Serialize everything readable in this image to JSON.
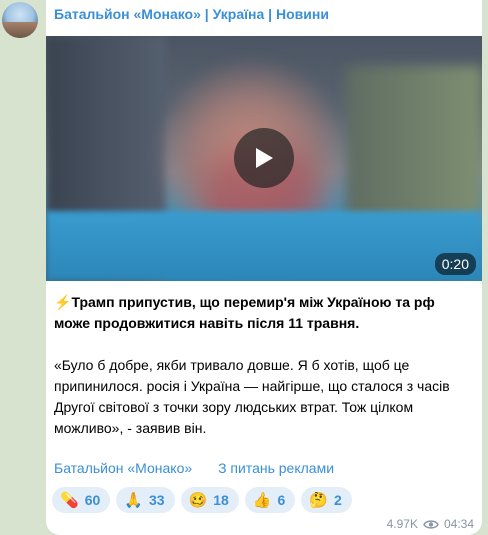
{
  "channel": {
    "title": "Батальйон «Монако» | Україна | Новини"
  },
  "video": {
    "duration": "0:20"
  },
  "post": {
    "headline_icon": "⚡",
    "headline": "Трамп припустив, що перемир'я між Україною та рф може продовжитися навіть після 11 травня.",
    "quote": "«Було б добре, якби тривало довше. Я б хотів, щоб це припинилося. росія і Україна — найгірше, що сталося з часів Другої світової з точки зору людських втрат. Тож цілком можливо», - заявив він."
  },
  "buttons": [
    {
      "label": "Батальйон «Монако»"
    },
    {
      "label": "З питань реклами"
    }
  ],
  "reactions": [
    {
      "emoji": "💊",
      "count": "60"
    },
    {
      "emoji": "🙏",
      "count": "33"
    },
    {
      "emoji": "🥴",
      "count": "18"
    },
    {
      "emoji": "👍",
      "count": "6"
    },
    {
      "emoji": "🤔",
      "count": "2"
    }
  ],
  "meta": {
    "views": "4.97K",
    "time": "04:34"
  },
  "colors": {
    "accent": "#3a8fd6",
    "background": "#d8e3cf",
    "bubble": "#ffffff"
  }
}
